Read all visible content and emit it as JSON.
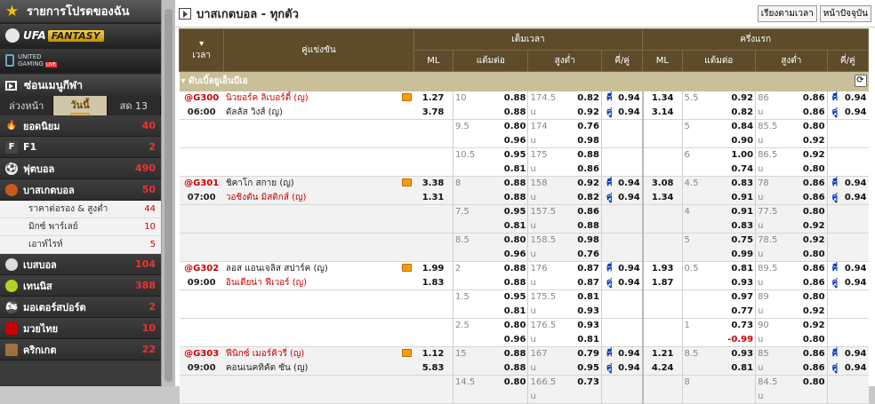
{
  "sidebar": {
    "promo_title": "รายการโปรดของฉัน",
    "banner1": {
      "main": "UFA",
      "tag": "FANTASY"
    },
    "banner2": {
      "l1": "UNITED",
      "l2": "GAMING",
      "tag": "LIVE"
    },
    "hidden_menu": "ซ่อนเมนูกีฬา",
    "tabs": [
      "ล่วงหน้า",
      "วันนี้",
      "สด 13"
    ],
    "active_tab": "วันนี้",
    "categories": [
      {
        "label": "ยอดนิยม",
        "count": "40",
        "icon": "fire-icon"
      },
      {
        "label": "F1",
        "count": "2",
        "icon": "f1-icon"
      },
      {
        "label": "ฟุตบอล",
        "count": "490",
        "icon": "soccer-icon"
      },
      {
        "label": "บาสเกตบอล",
        "count": "50",
        "icon": "basketball-icon"
      }
    ],
    "subitems": [
      {
        "label": "ราคาต่อรอง & สูงต่ำ",
        "count": "44"
      },
      {
        "label": "มิกซ์ พาร์เลย์",
        "count": "10"
      },
      {
        "label": "เอาท์ไรท์",
        "count": "5"
      }
    ],
    "categories2": [
      {
        "label": "เบสบอล",
        "count": "104",
        "icon": "baseball-icon"
      },
      {
        "label": "เทนนิส",
        "count": "388",
        "icon": "tennis-icon"
      },
      {
        "label": "มอเตอร์สปอร์ต",
        "count": "2",
        "icon": "motorsport-icon"
      },
      {
        "label": "มวยไทย",
        "count": "10",
        "icon": "boxing-icon"
      },
      {
        "label": "คริกเกต",
        "count": "22",
        "icon": "cricket-icon"
      }
    ]
  },
  "main": {
    "title": "บาสเกตบอล - ทุกตัว",
    "sort_button": "เรียงตามเวลา",
    "page_button": "หน้าปัจจุบัน",
    "headers": {
      "time": "เวลา",
      "match": "คู่แข่งขัน",
      "full": "เต็มเวลา",
      "half": "ครึ่งแรก",
      "ml": "ML",
      "hdp": "แต้มต่อ",
      "ou": "สูงต่ำ",
      "oe": "คี่/คู่"
    },
    "league": "ดับเบิ้ลยูเอ็นบีเอ",
    "matches": [
      {
        "code": "@G300",
        "time": "06:00",
        "home": "นิวยอร์ค ลิเบอร์ตี้ (ญ)",
        "away": "ดัลลัส วิงส์ (ญ)",
        "fav": "home",
        "rows": [
          {
            "ml1": "1.27",
            "ml2": "3.78",
            "h": "10",
            "hh": "0.88",
            "ha": "0.88",
            "ou": "174.5",
            "oh": "0.82",
            "oa": "0.92",
            "e1": "คี่",
            "ev1": "0.94",
            "e2": "คู่",
            "ev2": "0.94",
            "hml1": "1.34",
            "hml2": "3.14",
            "hh2": "5.5",
            "hH": "0.92",
            "hA": "0.82",
            "hou": "86",
            "hoH": "0.86",
            "hoA": "0.86",
            "he1": "คี่",
            "hev1": "0.94",
            "he2": "คู่",
            "hev2": "0.94"
          },
          {
            "h": "9.5",
            "hh": "0.80",
            "ha": "0.96",
            "ou": "174",
            "oh": "0.76",
            "oa": "0.98",
            "hh2": "5",
            "hH": "0.84",
            "hA": "0.90",
            "hou": "85.5",
            "hoH": "0.80",
            "hoA": "0.92"
          },
          {
            "h": "10.5",
            "hh": "0.95",
            "ha": "0.81",
            "ou": "175",
            "oh": "0.88",
            "oa": "0.86",
            "hh2": "6",
            "hH": "1.00",
            "hA": "0.74",
            "hou": "86.5",
            "hoH": "0.92",
            "hoA": "0.80"
          }
        ]
      },
      {
        "code": "@G301",
        "time": "07:00",
        "home": "ชิคาโก สกาย (ญ)",
        "away": "วอชิงตัน มิสติกส์ (ญ)",
        "fav": "away",
        "rows": [
          {
            "ml1": "3.38",
            "ml2": "1.31",
            "h": "8",
            "hh": "0.88",
            "ha": "0.88",
            "ou": "158",
            "oh": "0.92",
            "oa": "0.82",
            "e1": "คี่",
            "ev1": "0.94",
            "e2": "คู่",
            "ev2": "0.94",
            "hml1": "3.08",
            "hml2": "1.34",
            "hh2": "4.5",
            "hH": "0.83",
            "hA": "0.91",
            "hou": "78",
            "hoH": "0.86",
            "hoA": "0.86",
            "he1": "คี่",
            "hev1": "0.94",
            "he2": "คู่",
            "hev2": "0.94"
          },
          {
            "h": "7.5",
            "hh": "0.95",
            "ha": "0.81",
            "ou": "157.5",
            "oh": "0.86",
            "oa": "0.88",
            "hh2": "4",
            "hH": "0.91",
            "hA": "0.83",
            "hou": "77.5",
            "hoH": "0.80",
            "hoA": "0.92"
          },
          {
            "h": "8.5",
            "hh": "0.80",
            "ha": "0.96",
            "ou": "158.5",
            "oh": "0.98",
            "oa": "0.76",
            "hh2": "5",
            "hH": "0.75",
            "hA": "0.99",
            "hou": "78.5",
            "hoH": "0.92",
            "hoA": "0.80"
          }
        ]
      },
      {
        "code": "@G302",
        "time": "09:00",
        "home": "ลอส แอนเจลิส สปาร์ค (ญ)",
        "away": "อินเดียน่า ฟีเวอร์ (ญ)",
        "fav": "away",
        "rows": [
          {
            "ml1": "1.99",
            "ml2": "1.83",
            "h": "2",
            "hh": "0.88",
            "ha": "0.88",
            "ou": "176",
            "oh": "0.87",
            "oa": "0.87",
            "e1": "คี่",
            "ev1": "0.94",
            "e2": "คู่",
            "ev2": "0.94",
            "hml1": "1.93",
            "hml2": "1.87",
            "hh2": "0.5",
            "hH": "0.81",
            "hA": "0.93",
            "hou": "89.5",
            "hoH": "0.86",
            "hoA": "0.86",
            "he1": "คี่",
            "hev1": "0.94",
            "he2": "คู่",
            "hev2": "0.94"
          },
          {
            "h": "1.5",
            "hh": "0.95",
            "ha": "0.81",
            "ou": "175.5",
            "oh": "0.81",
            "oa": "0.93",
            "hh2": "",
            "hH": "0.97",
            "hA": "0.77",
            "hou": "89",
            "hoH": "0.80",
            "hoA": "0.92"
          },
          {
            "h": "2.5",
            "hh": "0.80",
            "ha": "0.96",
            "ou": "176.5",
            "oh": "0.93",
            "oa": "0.81",
            "hh2": "1",
            "hH": "0.73",
            "hA": "-0.99",
            "hou": "90",
            "hoH": "0.92",
            "hoA": "0.80"
          }
        ]
      },
      {
        "code": "@G303",
        "time": "09:00",
        "home": "ฟีนิกซ์ เมอร์คิวรี่ (ญ)",
        "away": "คอนเนคทิคัต ซัน (ญ)",
        "fav": "home",
        "rows": [
          {
            "ml1": "1.12",
            "ml2": "5.83",
            "h": "15",
            "hh": "0.88",
            "ha": "0.88",
            "ou": "167",
            "oh": "0.79",
            "oa": "0.95",
            "e1": "คี่",
            "ev1": "0.94",
            "e2": "คู่",
            "ev2": "0.94",
            "hml1": "1.21",
            "hml2": "4.24",
            "hh2": "8.5",
            "hH": "0.93",
            "hA": "0.81",
            "hou": "85",
            "hoH": "0.86",
            "hoA": "0.86",
            "he1": "คี่",
            "hev1": "0.94",
            "he2": "คู่",
            "hev2": "0.94"
          },
          {
            "h": "14.5",
            "hh": "0.80",
            "ha": "",
            "ou": "166.5",
            "oh": "0.73",
            "oa": "",
            "hh2": "8",
            "hH": "",
            "hA": "",
            "hou": "84.5",
            "hoH": "0.80",
            "hoA": ""
          }
        ]
      }
    ]
  }
}
